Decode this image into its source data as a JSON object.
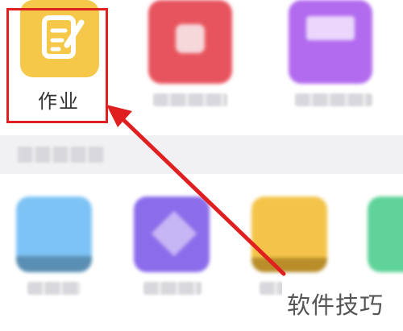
{
  "grid": {
    "featured_app": {
      "label": "作业",
      "icon": "notebook-pencil-icon",
      "color": "#F5C84A"
    },
    "blurred_apps_row1": [
      {
        "icon": "red-app-icon",
        "color": "#E8545E"
      },
      {
        "icon": "purple-app-icon",
        "color": "#B26BEF"
      }
    ],
    "section_header": "",
    "blurred_apps_row2": [
      {
        "icon": "blue-app-icon",
        "color": "#7EC3F5"
      },
      {
        "icon": "violet-app-icon",
        "color": "#8B6CEB"
      },
      {
        "icon": "yellow-app-icon",
        "color": "#F4C44A"
      },
      {
        "icon": "green-app-icon",
        "color": "#5FD39A"
      }
    ]
  },
  "annotation": {
    "color": "#E02020"
  },
  "watermark": {
    "text": "软件技巧"
  }
}
